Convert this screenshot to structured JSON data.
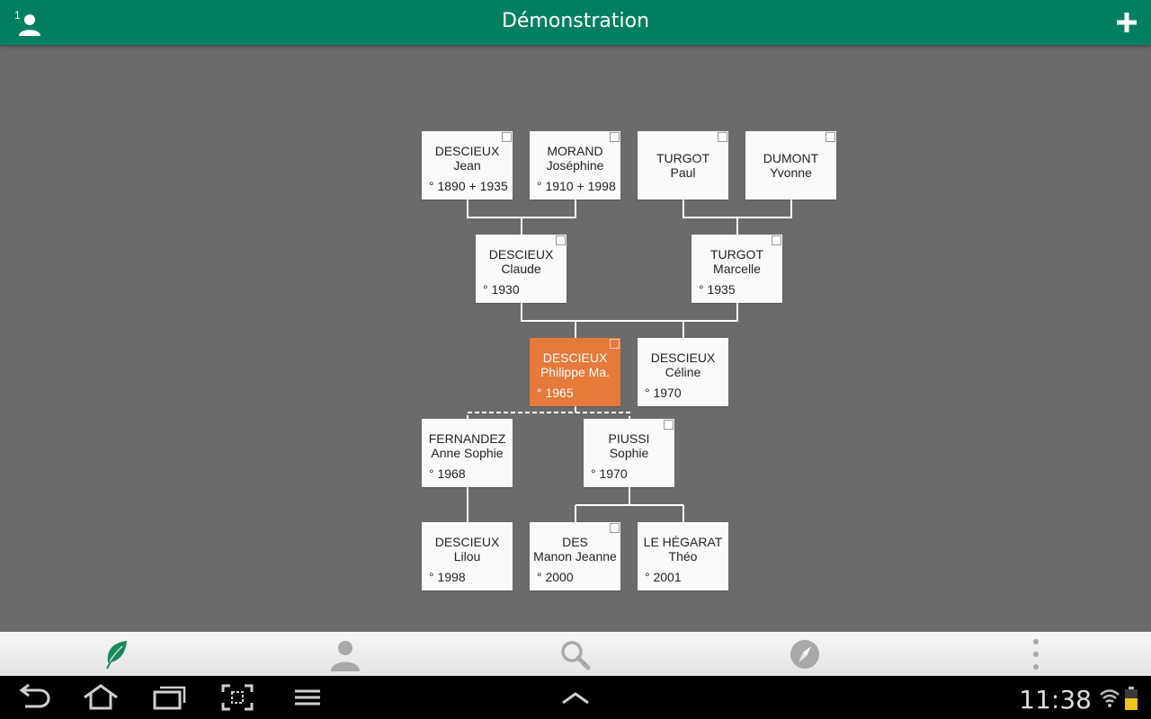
{
  "app": {
    "title": "Démonstration",
    "user_count": "1",
    "colors": {
      "primary": "#008060",
      "selected": "#e57a3b",
      "background": "#6b6b6b"
    }
  },
  "people": [
    {
      "id": "jean",
      "surname": "DESCIEUX",
      "given": "Jean",
      "dates": "° 1890  + 1935"
    },
    {
      "id": "josephine",
      "surname": "MORAND",
      "given": "Joséphine",
      "dates": "° 1910  + 1998"
    },
    {
      "id": "paul",
      "surname": "TURGOT",
      "given": "Paul",
      "dates": ""
    },
    {
      "id": "yvonne",
      "surname": "DUMONT",
      "given": "Yvonne",
      "dates": ""
    },
    {
      "id": "claude",
      "surname": "DESCIEUX",
      "given": "Claude",
      "dates": "° 1930"
    },
    {
      "id": "marcelle",
      "surname": "TURGOT",
      "given": "Marcelle",
      "dates": "° 1935"
    },
    {
      "id": "philippe",
      "surname": "DESCIEUX",
      "given": "Philippe Ma.",
      "dates": "° 1965"
    },
    {
      "id": "celine",
      "surname": "DESCIEUX",
      "given": "Céline",
      "dates": "° 1970"
    },
    {
      "id": "anne",
      "surname": "FERNANDEZ",
      "given": "Anne Sophie",
      "dates": "° 1968"
    },
    {
      "id": "sophie",
      "surname": "PIUSSI",
      "given": "Sophie",
      "dates": "° 1970"
    },
    {
      "id": "lilou",
      "surname": "DESCIEUX",
      "given": "Lilou",
      "dates": "° 1998"
    },
    {
      "id": "manon",
      "surname": "DES",
      "given": "Manon Jeanne",
      "dates": "° 2000"
    },
    {
      "id": "theo",
      "surname": "LE HÉGARAT",
      "given": "Théo",
      "dates": "° 2001"
    }
  ],
  "selected_person": "philippe",
  "bottom_nav": [
    {
      "name": "tree-tab",
      "icon": "leaf-icon",
      "active": true
    },
    {
      "name": "person-tab",
      "icon": "person-icon",
      "active": false
    },
    {
      "name": "search-tab",
      "icon": "search-icon",
      "active": false
    },
    {
      "name": "navigate-tab",
      "icon": "compass-icon",
      "active": false
    },
    {
      "name": "more-tab",
      "icon": "more-vertical-icon",
      "active": false
    }
  ],
  "system_bar": {
    "time": "11:38",
    "buttons": [
      "back-icon",
      "home-icon",
      "recent-apps-icon",
      "screenshot-icon",
      "menu-icon",
      "chevron-up-icon"
    ],
    "status_icons": [
      "wifi-icon",
      "battery-icon"
    ]
  }
}
